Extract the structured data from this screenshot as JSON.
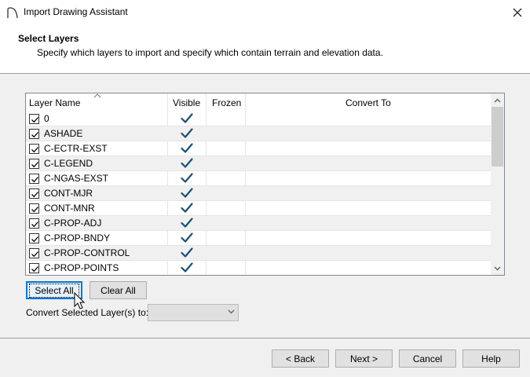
{
  "window": {
    "title": "Import Drawing Assistant"
  },
  "header": {
    "title": "Select Layers",
    "subtitle": "Specify which layers to import and specify which contain terrain and elevation data."
  },
  "table": {
    "columns": [
      "Layer Name",
      "Visible",
      "Frozen",
      "Convert To"
    ],
    "rows": [
      {
        "name": "0",
        "checked": true,
        "visible": true
      },
      {
        "name": "ASHADE",
        "checked": true,
        "visible": true
      },
      {
        "name": "C-ECTR-EXST",
        "checked": true,
        "visible": true
      },
      {
        "name": "C-LEGEND",
        "checked": true,
        "visible": true
      },
      {
        "name": "C-NGAS-EXST",
        "checked": true,
        "visible": true
      },
      {
        "name": "CONT-MJR",
        "checked": true,
        "visible": true
      },
      {
        "name": "CONT-MNR",
        "checked": true,
        "visible": true
      },
      {
        "name": "C-PROP-ADJ",
        "checked": true,
        "visible": true
      },
      {
        "name": "C-PROP-BNDY",
        "checked": true,
        "visible": true
      },
      {
        "name": "C-PROP-CONTROL",
        "checked": true,
        "visible": true
      },
      {
        "name": "C-PROP-POINTS",
        "checked": true,
        "visible": true
      }
    ]
  },
  "buttons": {
    "select_all": "Select All",
    "clear_all": "Clear All",
    "back": "< Back",
    "next": "Next >",
    "cancel": "Cancel",
    "help": "Help"
  },
  "convert": {
    "label": "Convert Selected Layer(s) to:",
    "value": ""
  },
  "colors": {
    "checkmark": "#1b4f72",
    "focus": "#0078d7"
  }
}
